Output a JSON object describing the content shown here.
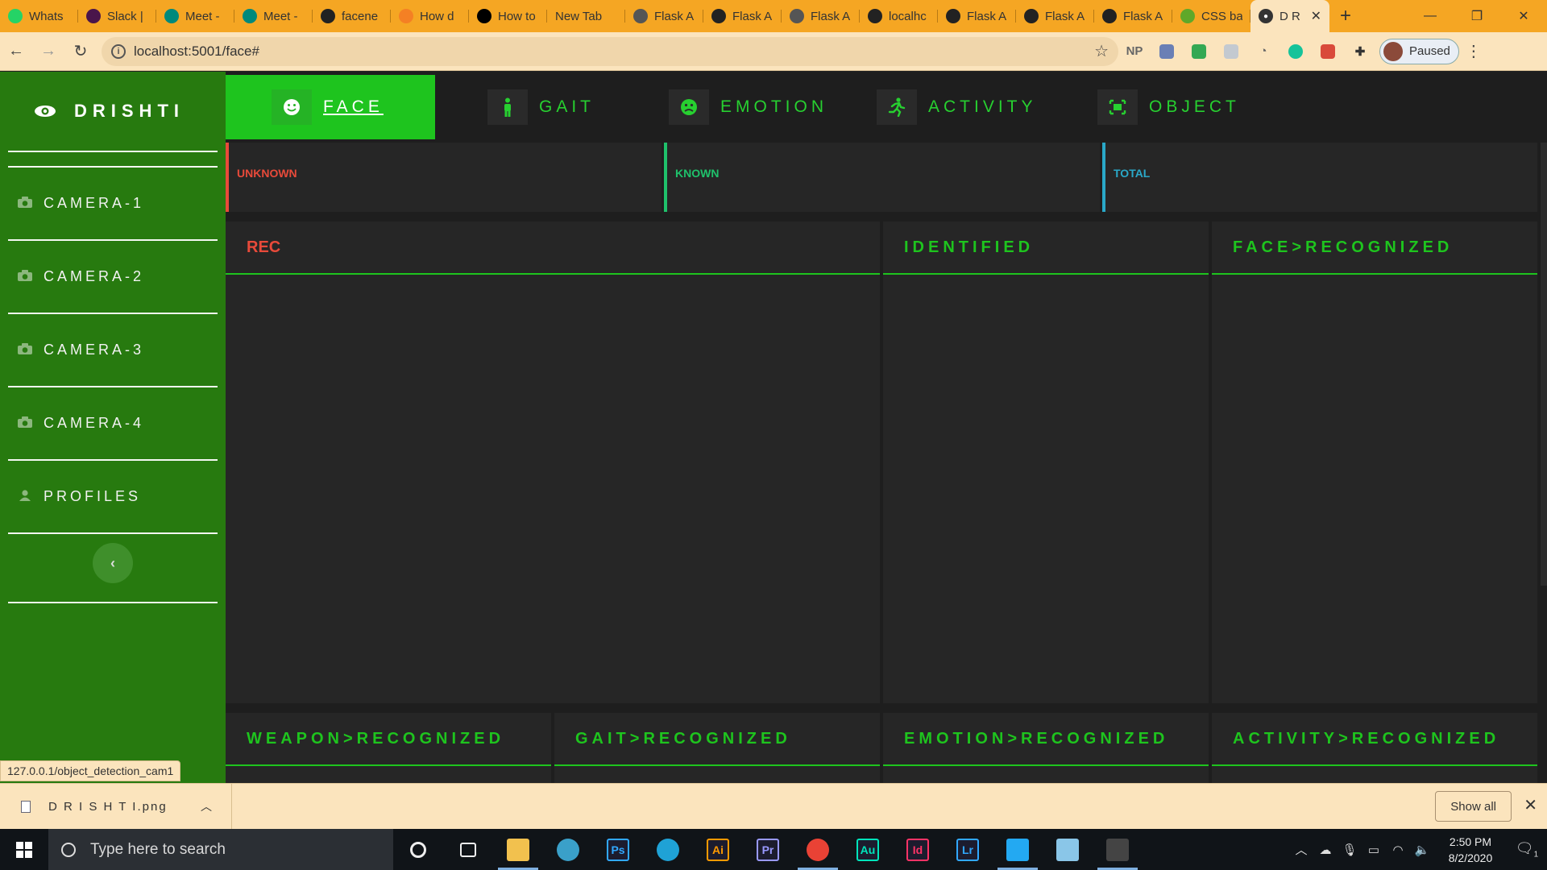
{
  "browser": {
    "tabs": [
      {
        "title": "Whats",
        "fav_color": "#25d366"
      },
      {
        "title": "Slack |",
        "fav_color": "#4a154b"
      },
      {
        "title": "Meet -",
        "fav_color": "#00897b"
      },
      {
        "title": "Meet -",
        "fav_color": "#00897b"
      },
      {
        "title": "facene",
        "fav_color": "#222222"
      },
      {
        "title": "How d",
        "fav_color": "#f48024"
      },
      {
        "title": "How to",
        "fav_color": "#000000"
      },
      {
        "title": "New Tab",
        "fav_color": ""
      },
      {
        "title": "Flask A",
        "fav_color": "#555555"
      },
      {
        "title": "Flask A",
        "fav_color": "#222222"
      },
      {
        "title": "Flask A",
        "fav_color": "#555555"
      },
      {
        "title": "localhc",
        "fav_color": "#222222"
      },
      {
        "title": "Flask A",
        "fav_color": "#222222"
      },
      {
        "title": "Flask A",
        "fav_color": "#222222"
      },
      {
        "title": "Flask A",
        "fav_color": "#222222"
      },
      {
        "title": "CSS ba",
        "fav_color": "#5fa829"
      }
    ],
    "active_tab": {
      "title": "D R"
    },
    "url": "localhost:5001/face#",
    "extensions": [
      "NP"
    ],
    "profile_label": "Paused",
    "status_url": "127.0.0.1/object_detection_cam1"
  },
  "sidebar": {
    "brand": "DRISHTI",
    "items": [
      {
        "label": "CAMERA-1",
        "icon": "camera-icon"
      },
      {
        "label": "CAMERA-2",
        "icon": "camera-icon"
      },
      {
        "label": "CAMERA-3",
        "icon": "camera-icon"
      },
      {
        "label": "CAMERA-4",
        "icon": "camera-icon"
      },
      {
        "label": "PROFILES",
        "icon": "user-icon"
      }
    ],
    "collapse_glyph": "‹"
  },
  "nav": {
    "tabs": [
      {
        "label": "FACE",
        "icon": "smile-icon",
        "active": true
      },
      {
        "label": "GAIT",
        "icon": "person-icon",
        "active": false
      },
      {
        "label": "EMOTION",
        "icon": "emotion-icon",
        "active": false
      },
      {
        "label": "ACTIVITY",
        "icon": "running-icon",
        "active": false
      },
      {
        "label": "OBJECT",
        "icon": "object-icon",
        "active": false
      }
    ]
  },
  "stats": [
    {
      "label": "UNKNOWN",
      "color": "#e84a3a"
    },
    {
      "label": "KNOWN",
      "color": "#1fc16b"
    },
    {
      "label": "TOTAL",
      "color": "#2aa8c8"
    }
  ],
  "panels": {
    "rec": "REC",
    "identified": "IDENTIFIED",
    "face_recognized": "FACE>RECOGNIZED",
    "weapon_recognized": "WEAPON>RECOGNIZED",
    "gait_recognized": "GAIT>RECOGNIZED",
    "emotion_recognized": "EMOTION>RECOGNIZED",
    "activity_recognized": "ACTIVITY>RECOGNIZED"
  },
  "colors": {
    "sidebar": "#277a0f",
    "accent": "#1ec41e",
    "panel": "#262626",
    "danger": "#e84a3a"
  },
  "downloads": {
    "file": "D R I S H T I.png",
    "show_all": "Show all"
  },
  "taskbar": {
    "search_placeholder": "Type here to search",
    "time": "2:50 PM",
    "date": "8/2/2020",
    "apps": [
      {
        "name": "cortana",
        "label": "",
        "color": ""
      },
      {
        "name": "task-view",
        "label": "",
        "color": ""
      },
      {
        "name": "file-explorer",
        "label": "",
        "color": "#f2c14e"
      },
      {
        "name": "app-circle",
        "label": "",
        "color": "#3aa0c9"
      },
      {
        "name": "photoshop",
        "label": "Ps",
        "color": "#31a8ff"
      },
      {
        "name": "edge",
        "label": "",
        "color": "#1fa2d6"
      },
      {
        "name": "illustrator",
        "label": "Ai",
        "color": "#ff9a00"
      },
      {
        "name": "premiere",
        "label": "Pr",
        "color": "#9999ff"
      },
      {
        "name": "chrome",
        "label": "",
        "color": "#e94235"
      },
      {
        "name": "audition",
        "label": "Au",
        "color": "#00e4bb"
      },
      {
        "name": "indesign",
        "label": "Id",
        "color": "#ff3366"
      },
      {
        "name": "lightroom",
        "label": "Lr",
        "color": "#31a8ff"
      },
      {
        "name": "vscode",
        "label": "",
        "color": "#23a9f2"
      },
      {
        "name": "app-blue",
        "label": "",
        "color": "#8ac6e8"
      },
      {
        "name": "terminal",
        "label": "",
        "color": "#444444"
      }
    ],
    "notification_count": "1"
  }
}
